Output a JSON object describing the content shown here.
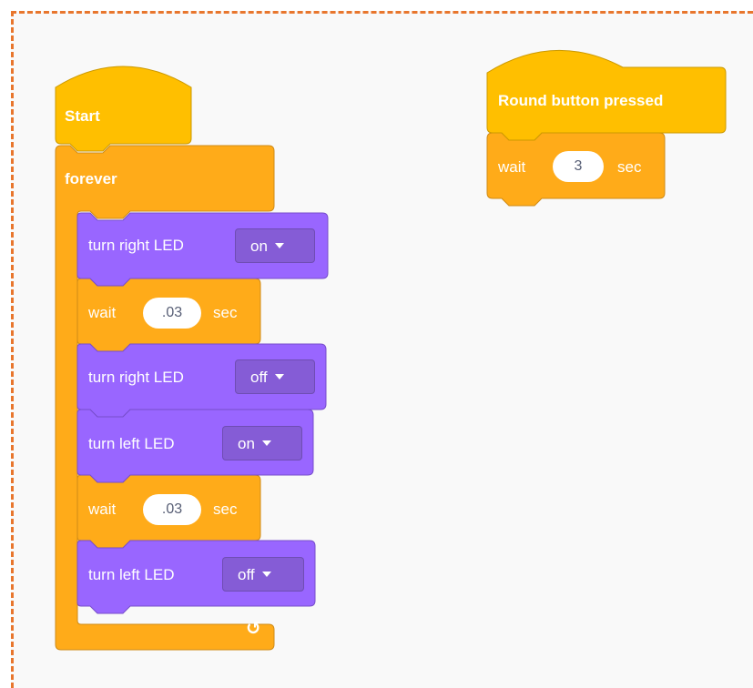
{
  "colors": {
    "event": "#ffbf00",
    "control": "#ffab19",
    "looks": "#9966ff",
    "frame_border": "#e8762d",
    "canvas": "#f9f9f9"
  },
  "script_left": {
    "hat": {
      "label": "Start"
    },
    "forever": {
      "label": "forever",
      "loop_icon": "↺"
    },
    "blocks": [
      {
        "type": "looks",
        "text": "turn right LED",
        "dropdown": "on"
      },
      {
        "type": "control",
        "text": "wait",
        "value": ".03",
        "unit": "sec"
      },
      {
        "type": "looks",
        "text": "turn right LED",
        "dropdown": "off"
      },
      {
        "type": "looks",
        "text": "turn left LED",
        "dropdown": "on"
      },
      {
        "type": "control",
        "text": "wait",
        "value": ".03",
        "unit": "sec"
      },
      {
        "type": "looks",
        "text": "turn left LED",
        "dropdown": "off"
      }
    ]
  },
  "script_right": {
    "hat": {
      "label": "Round button pressed"
    },
    "blocks": [
      {
        "type": "control",
        "text": "wait",
        "value": "3",
        "unit": "sec"
      }
    ]
  }
}
